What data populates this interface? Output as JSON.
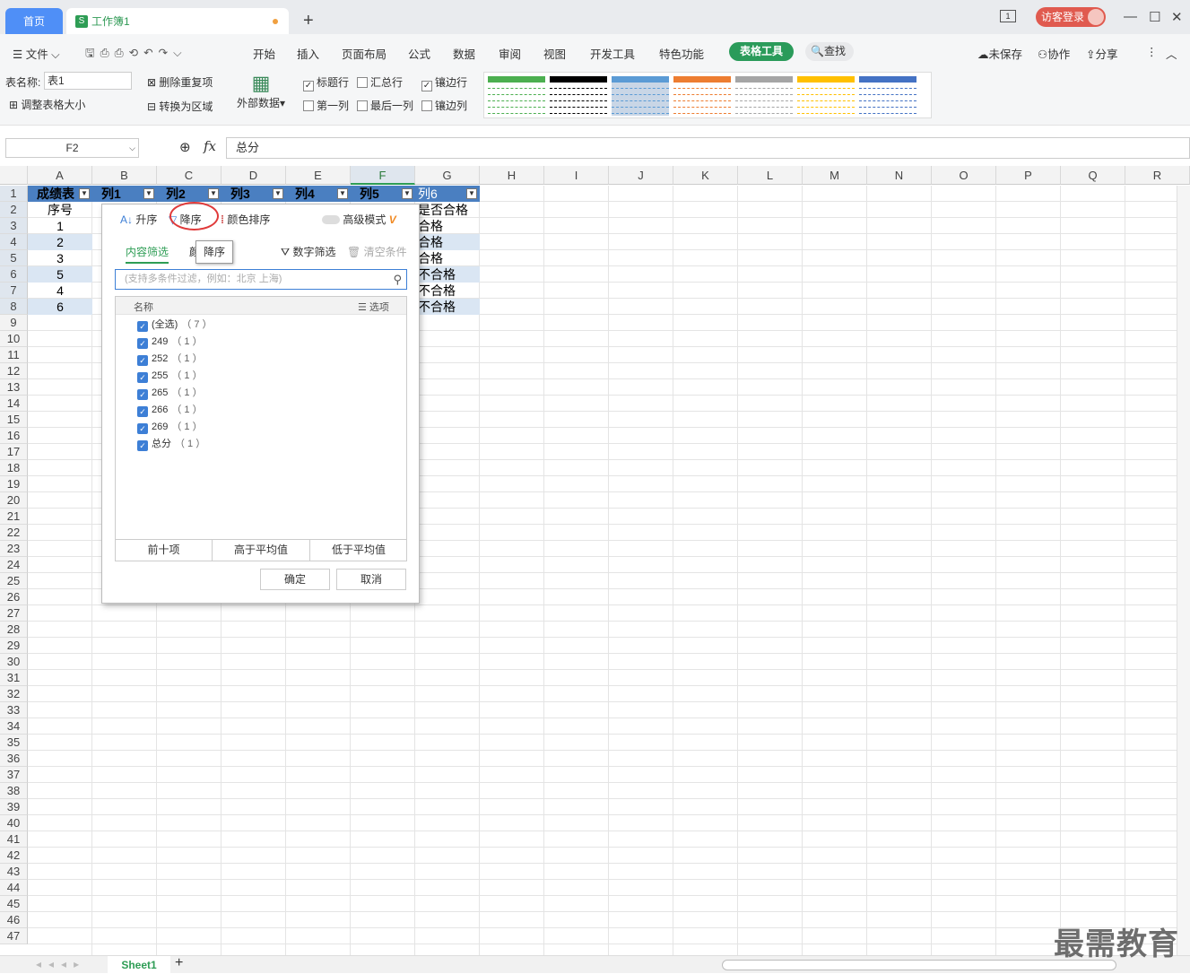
{
  "titlebar": {
    "home_tab": "首页",
    "workbook_tab": "工作簿1",
    "workbook_icon": "S",
    "login_button": "访客登录",
    "page_badge": "1"
  },
  "menu": {
    "file": "文件",
    "items": [
      "开始",
      "插入",
      "页面布局",
      "公式",
      "数据",
      "审阅",
      "视图",
      "开发工具",
      "特色功能"
    ],
    "table_tools": "表格工具",
    "find": "查找",
    "unsaved": "未保存",
    "collaborate": "协作",
    "share": "分享"
  },
  "ribbon": {
    "table_name_label": "表名称:",
    "table_name_value": "表1",
    "resize_table": "调整表格大小",
    "remove_duplicates": "删除重复项",
    "convert_range": "转换为区域",
    "external_data": "外部数据",
    "options": [
      {
        "label": "标题行",
        "checked": true
      },
      {
        "label": "汇总行",
        "checked": false
      },
      {
        "label": "镶边行",
        "checked": true
      },
      {
        "label": "第一列",
        "checked": false
      },
      {
        "label": "最后一列",
        "checked": false
      },
      {
        "label": "镶边列",
        "checked": false
      }
    ],
    "style_colors": [
      "#4caf50",
      "#000000",
      "#5b9bd5",
      "#ed7d31",
      "#a5a5a5",
      "#ffc000",
      "#4472c4"
    ]
  },
  "formula_bar": {
    "cell_ref": "F2",
    "fx": "fx",
    "content": "总分"
  },
  "columns": [
    "A",
    "B",
    "C",
    "D",
    "E",
    "F",
    "G",
    "H",
    "I",
    "J",
    "K",
    "L",
    "M",
    "N",
    "O",
    "P",
    "Q",
    "R"
  ],
  "rows_count": 47,
  "table": {
    "header": [
      "成绩表",
      "列1",
      "列2",
      "列3",
      "列4",
      "列5",
      "列6"
    ],
    "row2_a": "序号",
    "row2_g": "是否合格",
    "col_a": [
      "1",
      "2",
      "3",
      "5",
      "4",
      "6"
    ],
    "col_g": [
      "合格",
      "合格",
      "合格",
      "不合格",
      "不合格",
      "不合格"
    ]
  },
  "filter_popup": {
    "ascending": "升序",
    "descending": "降序",
    "color_sort": "颜色排序",
    "advanced_mode": "高级模式",
    "tab_content": "内容筛选",
    "tab_color_partial": "颜",
    "tooltip": "降序",
    "number_filter": "数字筛选",
    "clear_filter": "清空条件",
    "search_placeholder": "(支持多条件过滤，例如：北京  上海)",
    "list_header": "名称",
    "list_options": "选项",
    "items": [
      {
        "label": "(全选)",
        "count": "（ 7 ）"
      },
      {
        "label": "249",
        "count": "（ 1 ）"
      },
      {
        "label": "252",
        "count": "（ 1 ）"
      },
      {
        "label": "255",
        "count": "（ 1 ）"
      },
      {
        "label": "265",
        "count": "（ 1 ）"
      },
      {
        "label": "266",
        "count": "（ 1 ）"
      },
      {
        "label": "269",
        "count": "（ 1 ）"
      },
      {
        "label": "总分",
        "count": "（ 1 ）"
      }
    ],
    "top_ten": "前十项",
    "above_avg": "高于平均值",
    "below_avg": "低于平均值",
    "ok": "确定",
    "cancel": "取消"
  },
  "sheet_tab": "Sheet1",
  "watermark": "最需教育"
}
